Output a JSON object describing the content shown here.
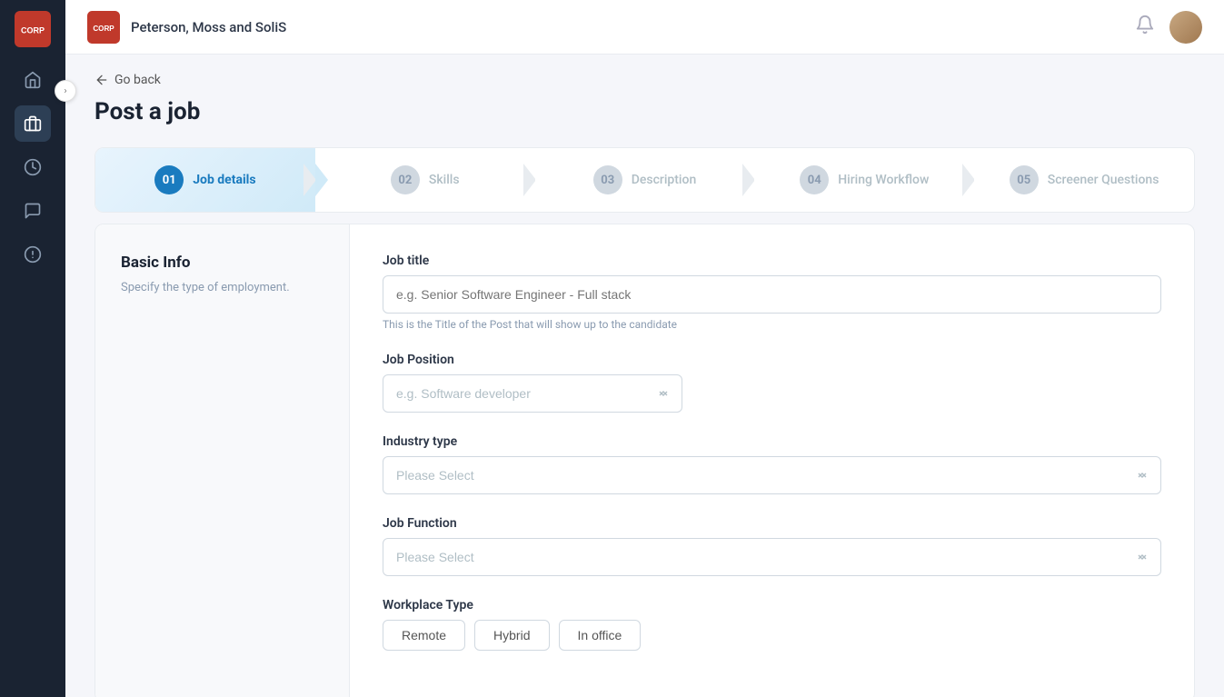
{
  "company": {
    "name": "Peterson, Moss and SoliS"
  },
  "page": {
    "title": "Post a job",
    "go_back_label": "Go back"
  },
  "steps": [
    {
      "id": "01",
      "label": "Job details",
      "active": true
    },
    {
      "id": "02",
      "label": "Skills",
      "active": false
    },
    {
      "id": "03",
      "label": "Description",
      "active": false
    },
    {
      "id": "04",
      "label": "Hiring Workflow",
      "active": false
    },
    {
      "id": "05",
      "label": "Screener Questions",
      "active": false
    }
  ],
  "basic_info": {
    "title": "Basic Info",
    "description": "Specify the type of employment."
  },
  "fields": {
    "job_title": {
      "label": "Job title",
      "placeholder": "e.g. Senior Software Engineer - Full stack",
      "hint": "This is the Title of the Post that will show up to the candidate"
    },
    "job_position": {
      "label": "Job Position",
      "placeholder": "e.g. Software developer"
    },
    "industry_type": {
      "label": "Industry type",
      "placeholder": "Please Select"
    },
    "job_function": {
      "label": "Job Function",
      "placeholder": "Please Select"
    },
    "workplace_type": {
      "label": "Workplace Type",
      "options": [
        "Remote",
        "Hybrid",
        "In office"
      ]
    }
  },
  "icons": {
    "home": "⌂",
    "briefcase": "💼",
    "clock": "🕐",
    "chat": "💬",
    "info": "ℹ",
    "bell": "🔔",
    "back_arrow": "←",
    "expand": "›"
  },
  "colors": {
    "active_step": "#1a7bbf",
    "sidebar_bg": "#1a2332",
    "accent": "#1a7bbf"
  }
}
